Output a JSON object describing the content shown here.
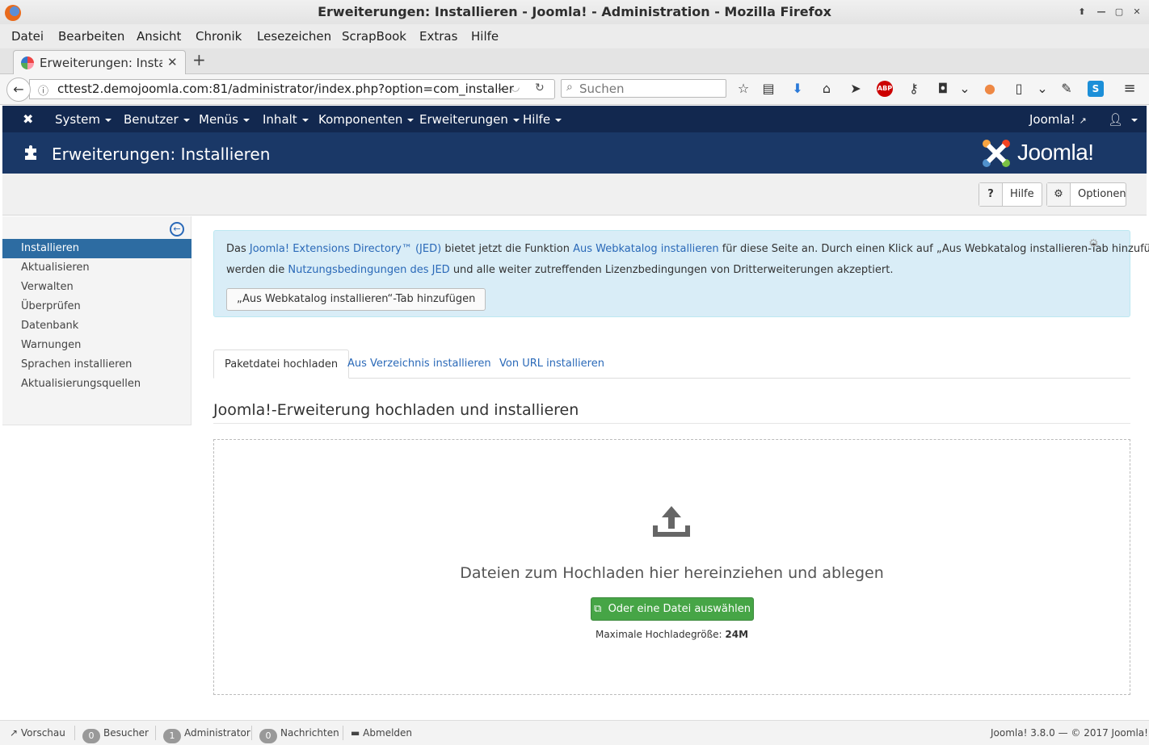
{
  "window": {
    "title": "Erweiterungen: Installieren - Joomla! - Administration - Mozilla Firefox"
  },
  "menubar": [
    "Datei",
    "Bearbeiten",
    "Ansicht",
    "Chronik",
    "Lesezeichen",
    "ScrapBook",
    "Extras",
    "Hilfe"
  ],
  "browser_tab": {
    "title": "Erweiterungen: Installieren - Joomla! - Administration"
  },
  "address_bar": {
    "url": "cttest2.demojoomla.com:81/administrator/index.php?option=com_installer"
  },
  "search": {
    "placeholder": "Suchen"
  },
  "toolbar_icons": [
    "star-icon",
    "reading-list-icon",
    "download-icon",
    "home-icon",
    "send-icon",
    "adblock-icon",
    "sync-icon",
    "pocket-icon",
    "chevron-down-icon",
    "colorful-addon-icon",
    "clipboard-icon",
    "chevron-down-icon",
    "evernote-icon",
    "skype-icon",
    "hamburger-menu-icon"
  ],
  "joomla_nav": {
    "items": [
      "System",
      "Benutzer",
      "Menüs",
      "Inhalt",
      "Komponenten",
      "Erweiterungen",
      "Hilfe"
    ],
    "site_link": "Joomla!"
  },
  "header": {
    "title": "Erweiterungen: Installieren",
    "logo_text": "Joomla!"
  },
  "page_toolbar": {
    "help_label": "Hilfe",
    "options_label": "Optionen"
  },
  "sidebar": {
    "items": [
      {
        "label": "Installieren",
        "active": true
      },
      {
        "label": "Aktualisieren"
      },
      {
        "label": "Verwalten"
      },
      {
        "label": "Überprüfen"
      },
      {
        "label": "Datenbank"
      },
      {
        "label": "Warnungen"
      },
      {
        "label": "Sprachen installieren"
      },
      {
        "label": "Aktualisierungsquellen"
      }
    ]
  },
  "alert": {
    "l1_a": "Das ",
    "l1_link1": "Joomla! Extensions Directory™ (JED)",
    "l1_b": " bietet jetzt die Funktion ",
    "l1_link2": "Aus Webkatalog installieren",
    "l1_c": " für diese Seite an. Durch einen Klick auf „Aus Webkatalog installieren-Tab hinzufügen“,",
    "l2_a": "werden die ",
    "l2_link": "Nutzungsbedingungen des JED",
    "l2_b": " und alle weiter zutreffenden Lizenzbedingungen von Dritterweiterungen akzeptiert.",
    "button": "„Aus Webkatalog installieren“-Tab hinzufügen"
  },
  "tabs": [
    "Paketdatei hochladen",
    "Aus Verzeichnis installieren",
    "Von URL installieren"
  ],
  "upload": {
    "section_title": "Joomla!-Erweiterung hochladen und installieren",
    "drop_text": "Dateien zum Hochladen hier hereinziehen und ablegen",
    "choose_button": "Oder eine Datei auswählen",
    "max_label": "Maximale Hochladegröße: ",
    "max_value": "24M"
  },
  "statusbar": {
    "preview": "Vorschau",
    "visitors_count": "0",
    "visitors_label": "Besucher",
    "admin_count": "1",
    "admin_label": "Administrator",
    "messages_count": "0",
    "messages_label": "Nachrichten",
    "logout": "Abmelden",
    "version": "Joomla! 3.8.0  —  © 2017 Joomla!"
  }
}
